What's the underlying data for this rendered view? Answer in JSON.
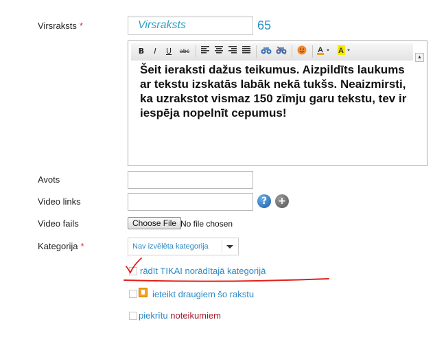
{
  "form": {
    "title_label": "Virsraksts",
    "required_mark": "*",
    "title_value": "Virsraksts",
    "title_counter": "65",
    "editor": {
      "toolbar": {
        "bold": "B",
        "italic": "I",
        "underline": "U",
        "strike": "abc"
      },
      "content": "Šeit ieraksti dažus teikumus. Aizpildīts laukums ar tekstu izskatās labāk nekā tukšs. Neaizmirsti, ka uzrakstot vismaz 150 zīmju garu tekstu, tev ir iespēja nopelnīt cepumus!"
    },
    "source_label": "Avots",
    "source_value": "",
    "video_link_label": "Video links",
    "video_link_value": "",
    "video_file_label": "Video fails",
    "choose_file_label": "Choose File",
    "no_file_text": "No file chosen",
    "category_label": "Kategorija",
    "category_selected": "Nav izvēlēta kategorija",
    "only_category_text": "rādīt TIKAI norādītajā kategorijā",
    "recommend_text": "ieteikt draugiem šo rakstu",
    "agree_prefix": "piekrītu ",
    "agree_link": "noteikumiem"
  },
  "colors": {
    "accent_blue": "#2a88c4",
    "required_red": "#e03030",
    "annotation_red": "#e0201a",
    "link_red": "#a0182a"
  },
  "icons": {
    "help": "question-icon",
    "add": "plus-icon"
  }
}
